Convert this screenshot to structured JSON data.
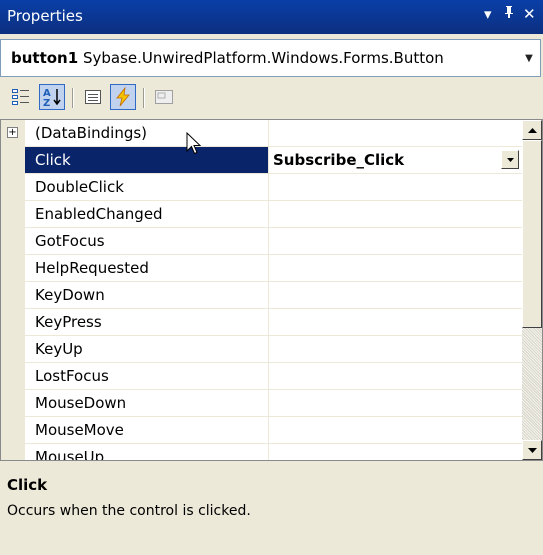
{
  "window": {
    "title": "Properties",
    "controls": {
      "dropdown": "▾",
      "pin": "ᵽ",
      "close": "✕"
    }
  },
  "object_selector": {
    "name": "button1",
    "type": "Sybase.UnwiredPlatform.Windows.Forms.Button"
  },
  "toolbar": {
    "buttons": [
      {
        "icon": "categorized-icon",
        "selected": false
      },
      {
        "icon": "alphabetical-icon",
        "selected": true
      },
      {
        "icon": "properties-icon",
        "selected": false
      },
      {
        "icon": "events-icon",
        "selected": true
      },
      {
        "icon": "property-pages-icon",
        "selected": false,
        "disabled": true
      }
    ]
  },
  "grid": {
    "rows": [
      {
        "name": "(DataBindings)",
        "value": "",
        "expandable": true,
        "expand_glyph": "+"
      },
      {
        "name": "Click",
        "value": "Subscribe_Click",
        "selected": true
      },
      {
        "name": "DoubleClick",
        "value": ""
      },
      {
        "name": "EnabledChanged",
        "value": ""
      },
      {
        "name": "GotFocus",
        "value": ""
      },
      {
        "name": "HelpRequested",
        "value": ""
      },
      {
        "name": "KeyDown",
        "value": ""
      },
      {
        "name": "KeyPress",
        "value": ""
      },
      {
        "name": "KeyUp",
        "value": ""
      },
      {
        "name": "LostFocus",
        "value": ""
      },
      {
        "name": "MouseDown",
        "value": ""
      },
      {
        "name": "MouseMove",
        "value": ""
      },
      {
        "name": "MouseUp",
        "value": ""
      }
    ]
  },
  "description": {
    "title": "Click",
    "text": "Occurs when the control is clicked."
  },
  "colors": {
    "title_bar": "#0c3a9c",
    "selection": "#0a246a",
    "panel": "#ece9d8"
  }
}
